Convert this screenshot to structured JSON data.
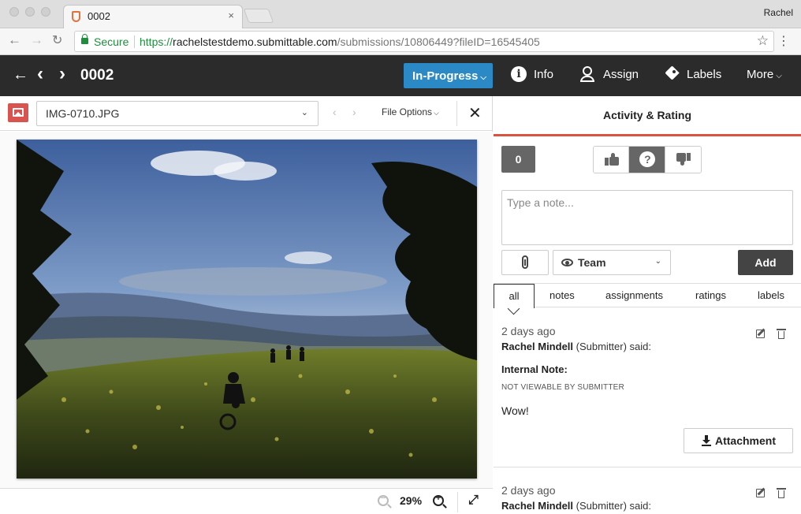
{
  "browser": {
    "tab_title": "0002",
    "tab_close": "×",
    "profile": "Rachel",
    "security_label": "Secure",
    "url_scheme": "https://",
    "url_host": "rachelstestdemo.submittable.com",
    "url_path": "/submissions/10806449?fileID=16545405",
    "icons": [
      "back-icon",
      "forward-icon",
      "reload-icon",
      "lock-icon",
      "star-icon",
      "menu-icon"
    ]
  },
  "appbar": {
    "back": "←",
    "prev": "‹",
    "next": "›",
    "submission_id": "0002",
    "status_label": "In-Progress",
    "info_label": "Info",
    "assign_label": "Assign",
    "labels_label": "Labels",
    "more_label": "More",
    "status_color": "#2b8ac6"
  },
  "file_viewer": {
    "file_name": "IMG-0710.JPG",
    "file_options_label": "File Options",
    "zoom_level": "29%",
    "image_subject": "mountain biker on a hillside meadow with wildflowers at sunset"
  },
  "panel": {
    "title": "Activity & Rating",
    "score": "0",
    "rating_options": [
      "thumbs-up-icon",
      "question-icon",
      "thumbs-down-icon"
    ],
    "rating_selected": "question",
    "note_placeholder": "Type a note...",
    "visibility_label": "Team",
    "add_label": "Add",
    "filters": [
      "all",
      "notes",
      "assignments",
      "ratings",
      "labels"
    ],
    "active_filter": "all",
    "accent_color": "#d9533e"
  },
  "activity": [
    {
      "when": "2 days ago",
      "author": "Rachel Mindell",
      "role_suffix": " (Submitter) said:",
      "note_type": "Internal Note:",
      "visibility_note": "NOT VIEWABLE BY SUBMITTER",
      "message": "Wow!",
      "attachment_label": "Attachment"
    },
    {
      "when": "2 days ago",
      "author": "Rachel Mindell",
      "role_suffix": " (Submitter) said:"
    }
  ]
}
